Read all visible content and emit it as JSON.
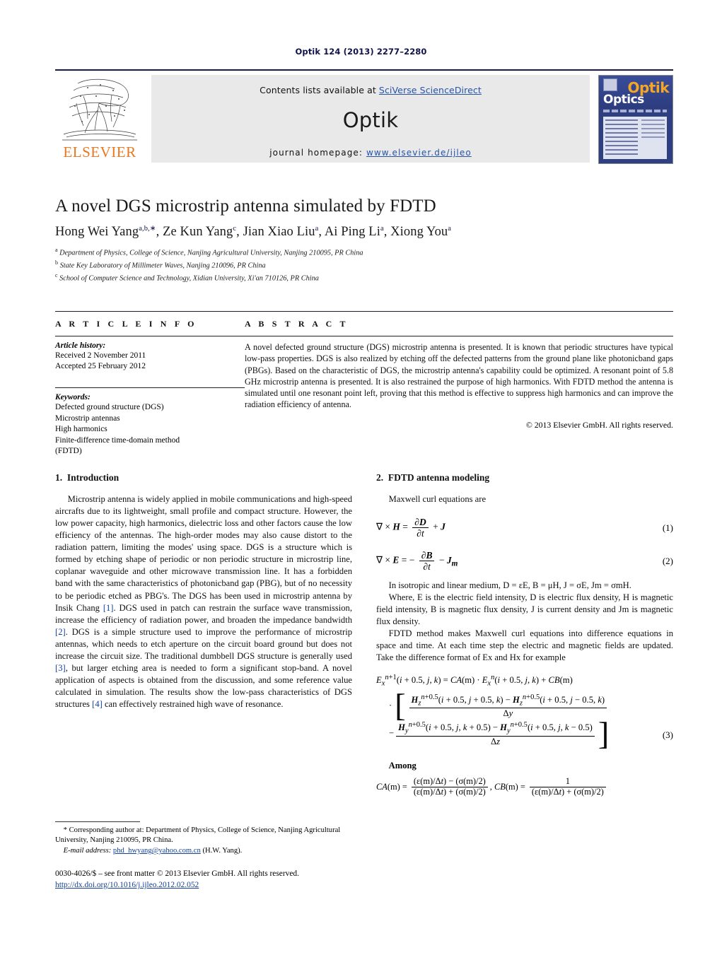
{
  "running_head": "Optik 124 (2013) 2277–2280",
  "masthead": {
    "contents_prefix": "Contents lists available at ",
    "contents_link": "SciVerse ScienceDirect",
    "journal_name": "Optik",
    "homepage_prefix": "journal homepage: ",
    "homepage_url": "www.elsevier.de/ijleo",
    "publisher_wordmark": "ELSEVIER",
    "cover": {
      "title_main": "Optik",
      "title_sub": "Optics",
      "accent_color": "#f5a623",
      "background_color": "#2e3f82"
    }
  },
  "article": {
    "title": "A novel DGS microstrip antenna simulated by FDTD",
    "authors": [
      {
        "name": "Hong Wei Yang",
        "sup": "a,b,∗"
      },
      {
        "name": "Ze Kun Yang",
        "sup": "c"
      },
      {
        "name": "Jian Xiao Liu",
        "sup": "a"
      },
      {
        "name": "Ai Ping Li",
        "sup": "a"
      },
      {
        "name": "Xiong You",
        "sup": "a"
      }
    ],
    "affiliations": [
      {
        "label": "a",
        "text": "Department of Physics, College of Science, Nanjing Agricultural University, Nanjing 210095, PR China"
      },
      {
        "label": "b",
        "text": "State Key Laboratory of Millimeter Waves, Nanjing 210096, PR China"
      },
      {
        "label": "c",
        "text": "School of Computer Science and Technology, Xidian University, Xi'an 710126, PR China"
      }
    ]
  },
  "article_info": {
    "heading": "A R T I C L E   I N F O",
    "history_label": "Article history:",
    "received": "Received 2 November 2011",
    "accepted": "Accepted 25 February 2012",
    "keywords_label": "Keywords:",
    "keywords": [
      "Defected ground structure (DGS)",
      "Microstrip antennas",
      "High harmonics",
      "Finite-difference time-domain method",
      "(FDTD)"
    ]
  },
  "abstract": {
    "heading": "A B S T R A C T",
    "text": "A novel defected ground structure (DGS) microstrip antenna is presented. It is known that periodic structures have typical low-pass properties. DGS is also realized by etching off the defected patterns from the ground plane like photonicband gaps (PBGs). Based on the characteristic of DGS, the microstrip antenna's capability could be optimized. A resonant point of 5.8 GHz microstrip antenna is presented. It is also restrained the purpose of high harmonics. With FDTD method the antenna is simulated until one resonant point left, proving that this method is effective to suppress high harmonics and can improve the radiation efficiency of antenna.",
    "copyright": "© 2013 Elsevier GmbH. All rights reserved."
  },
  "sections": {
    "introduction": {
      "number": "1.",
      "title": "Introduction",
      "paragraph": "Microstrip antenna is widely applied in mobile communications and high-speed aircrafts due to its lightweight, small profile and compact structure. However, the low power capacity, high harmonics, dielectric loss and other factors cause the low efficiency of the antennas. The high-order modes may also cause distort to the radiation pattern, limiting the modes' using space. DGS is a structure which is formed by etching shape of periodic or non periodic structure in microstrip line, coplanar waveguide and other microwave transmission line. It has a forbidden band with the same characteristics of photonicband gap (PBG), but of no necessity to be periodic etched as PBG's. The DGS has been used in microstrip antenna by Insik Chang",
      "ref1": "[1]",
      "part2": ". DGS used in patch can restrain the surface wave transmission, increase the efficiency of radiation power, and broaden the impedance bandwidth",
      "ref2": "[2]",
      "part3": ". DGS is a simple structure used to improve the performance of microstrip antennas, which needs to etch aperture on the circuit board ground but does not increase the circuit size. The traditional dumbbell DGS structure is generally used",
      "ref3": "[3]",
      "part4": ", but larger etching area is needed to form a significant stop-band. A novel application of aspects is obtained from the discussion, and some reference value calculated in simulation. The results show the low-pass characteristics of DGS structures",
      "ref4": "[4]",
      "part5": " can effectively restrained high wave of resonance."
    },
    "fdtd": {
      "number": "2.",
      "title": "FDTD antenna modeling",
      "intro_line": "Maxwell curl equations are",
      "eq1_num": "(1)",
      "eq2_num": "(2)",
      "isotropic_line": "In isotropic and linear medium, D = εE, B = μH, J = σE, Jm = σmH.",
      "where_para": "Where, E is the electric field intensity, D is electric flux density, H is magnetic field intensity, B is magnetic flux density, J is current density and Jm is magnetic flux density.",
      "fdtd_para": "FDTD method makes Maxwell curl equations into difference equations in space and time. At each time step the electric and magnetic fields are updated. Take the difference format of Ex and Hx for example",
      "eq3_num": "(3)",
      "among_label": "Among"
    }
  },
  "footnote": {
    "corresponding": "* Corresponding author at: Department of Physics, College of Science, Nanjing Agricultural University, Nanjing 210095, PR China.",
    "email_label": "E-mail address:",
    "email": "phd_hwyang@yahoo.com.cn",
    "email_author": "(H.W. Yang)."
  },
  "footer": {
    "issn_line": "0030-4026/$ – see front matter © 2013 Elsevier GmbH. All rights reserved.",
    "doi": "http://dx.doi.org/10.1016/j.ijleo.2012.02.052"
  }
}
